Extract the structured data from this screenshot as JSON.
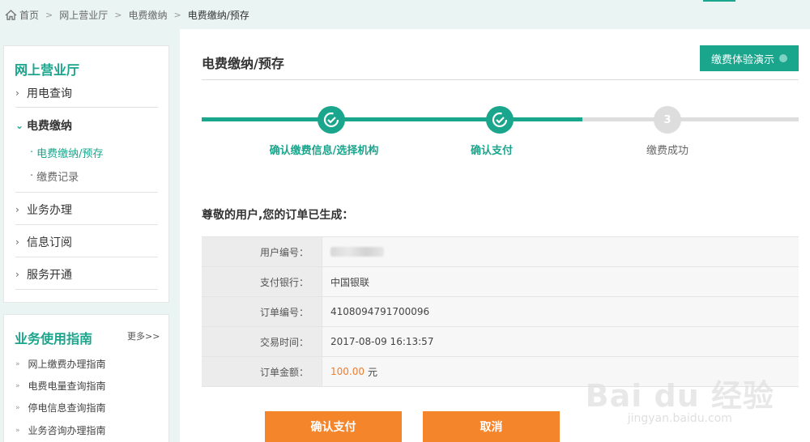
{
  "breadcrumb": {
    "items": [
      "首页",
      "网上营业厅",
      "电费缴纳",
      "电费缴纳/预存"
    ]
  },
  "sidebar": {
    "title": "网上营业厅",
    "items": [
      {
        "label": "用电查询"
      },
      {
        "label": "电费缴纳"
      },
      {
        "label": "业务办理"
      },
      {
        "label": "信息订阅"
      },
      {
        "label": "服务开通"
      }
    ],
    "subitems": [
      {
        "label": "电费缴纳/预存"
      },
      {
        "label": "缴费记录"
      }
    ]
  },
  "guide": {
    "title": "业务使用指南",
    "more": "更多>>",
    "items": [
      "网上缴费办理指南",
      "电费电量查询指南",
      "停电信息查询指南",
      "业务咨询办理指南"
    ]
  },
  "main": {
    "title": "电费缴纳/预存",
    "demo_button": "缴费体验演示",
    "steps": [
      {
        "label": "确认缴费信息/选择机构",
        "status": "done"
      },
      {
        "label": "确认支付",
        "status": "done"
      },
      {
        "label": "缴费成功",
        "number": "3",
        "status": "pending"
      }
    ],
    "greeting": "尊敬的用户,您的订单已生成：",
    "order": {
      "user_id_label": "用户编号：",
      "bank_label": "支付银行：",
      "bank_value": "中国银联",
      "order_no_label": "订单编号：",
      "order_no_value": "4108094791700096",
      "time_label": "交易时间：",
      "time_value": "2017-08-09 16:13:57",
      "amount_label": "订单金额：",
      "amount_value": "100.00",
      "amount_unit": "元"
    },
    "confirm_button": "确认支付",
    "cancel_button": "取消"
  },
  "watermark": {
    "logo": "Bai du 经验",
    "url": "jingyan.baidu.com"
  },
  "colors": {
    "accent": "#1aa58d",
    "button": "#f5852a",
    "amount": "#f07c32",
    "background": "#eaf4f3"
  }
}
